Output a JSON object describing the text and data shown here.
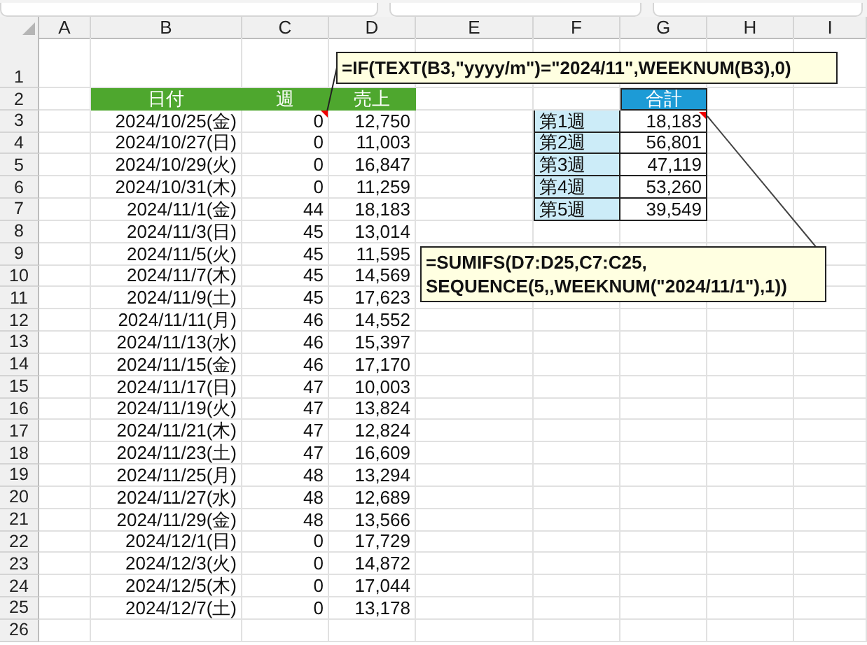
{
  "columns": [
    "A",
    "B",
    "C",
    "D",
    "E",
    "F",
    "G",
    "H",
    "I"
  ],
  "row_numbers": [
    "1",
    "2",
    "3",
    "4",
    "5",
    "6",
    "7",
    "8",
    "9",
    "10",
    "11",
    "12",
    "13",
    "14",
    "15",
    "16",
    "17",
    "18",
    "19",
    "20",
    "21",
    "22",
    "23",
    "24",
    "25",
    "26"
  ],
  "sales_table": {
    "headers": [
      "日付",
      "週",
      "売上"
    ],
    "rows": [
      {
        "date": "2024/10/25(金)",
        "week": "0",
        "sales": "12,750"
      },
      {
        "date": "2024/10/27(日)",
        "week": "0",
        "sales": "11,003"
      },
      {
        "date": "2024/10/29(火)",
        "week": "0",
        "sales": "16,847"
      },
      {
        "date": "2024/10/31(木)",
        "week": "0",
        "sales": "11,259"
      },
      {
        "date": "2024/11/1(金)",
        "week": "44",
        "sales": "18,183"
      },
      {
        "date": "2024/11/3(日)",
        "week": "45",
        "sales": "13,014"
      },
      {
        "date": "2024/11/5(火)",
        "week": "45",
        "sales": "11,595"
      },
      {
        "date": "2024/11/7(木)",
        "week": "45",
        "sales": "14,569"
      },
      {
        "date": "2024/11/9(土)",
        "week": "45",
        "sales": "17,623"
      },
      {
        "date": "2024/11/11(月)",
        "week": "46",
        "sales": "14,552"
      },
      {
        "date": "2024/11/13(水)",
        "week": "46",
        "sales": "15,397"
      },
      {
        "date": "2024/11/15(金)",
        "week": "46",
        "sales": "17,170"
      },
      {
        "date": "2024/11/17(日)",
        "week": "47",
        "sales": "10,003"
      },
      {
        "date": "2024/11/19(火)",
        "week": "47",
        "sales": "13,824"
      },
      {
        "date": "2024/11/21(木)",
        "week": "47",
        "sales": "12,824"
      },
      {
        "date": "2024/11/23(土)",
        "week": "47",
        "sales": "16,609"
      },
      {
        "date": "2024/11/25(月)",
        "week": "48",
        "sales": "13,294"
      },
      {
        "date": "2024/11/27(水)",
        "week": "48",
        "sales": "12,689"
      },
      {
        "date": "2024/11/29(金)",
        "week": "48",
        "sales": "13,566"
      },
      {
        "date": "2024/12/1(日)",
        "week": "0",
        "sales": "17,729"
      },
      {
        "date": "2024/12/3(火)",
        "week": "0",
        "sales": "14,872"
      },
      {
        "date": "2024/12/5(木)",
        "week": "0",
        "sales": "17,044"
      },
      {
        "date": "2024/12/7(土)",
        "week": "0",
        "sales": "13,178"
      }
    ]
  },
  "summary_table": {
    "header": "合計",
    "rows": [
      {
        "label": "第1週",
        "total": "18,183"
      },
      {
        "label": "第2週",
        "total": "56,801"
      },
      {
        "label": "第3週",
        "total": "47,119"
      },
      {
        "label": "第4週",
        "total": "53,260"
      },
      {
        "label": "第5週",
        "total": "39,549"
      }
    ]
  },
  "callouts": [
    {
      "lines": [
        "=IF(TEXT(B3,\"yyyy/m\")=\"2024/11\",WEEKNUM(B3),0)"
      ]
    },
    {
      "lines": [
        "=SUMIFS(D7:D25,C7:C25,",
        "SEQUENCE(5,,WEEKNUM(\"2024/11/1\"),1))"
      ]
    }
  ]
}
